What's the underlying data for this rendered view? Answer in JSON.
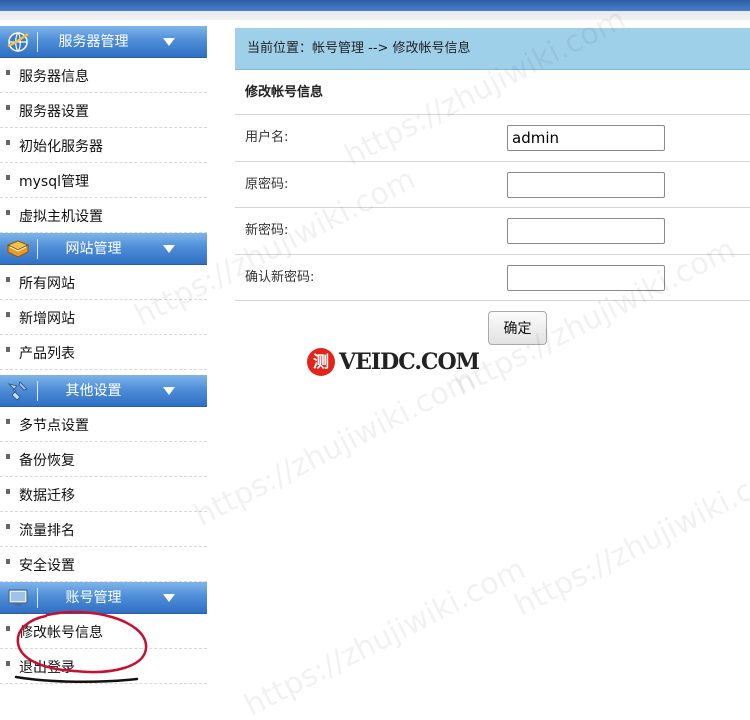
{
  "sidebar": {
    "sections": [
      {
        "title": "服务器管理",
        "items": [
          "服务器信息",
          "服务器设置",
          "初始化服务器",
          "mysql管理",
          "虚拟主机设置"
        ]
      },
      {
        "title": "网站管理",
        "items": [
          "所有网站",
          "新增网站",
          "产品列表"
        ]
      },
      {
        "title": "其他设置",
        "items": [
          "多节点设置",
          "备份恢复",
          "数据迁移",
          "流量排名",
          "安全设置"
        ]
      },
      {
        "title": "账号管理",
        "items": [
          "修改帐号信息",
          "退出登录"
        ]
      }
    ]
  },
  "breadcrumb": {
    "text": "当前位置：帐号管理 --> 修改帐号信息"
  },
  "form": {
    "title": "修改帐号信息",
    "username_label": "用户名:",
    "username_value": "admin",
    "old_password_label": "原密码:",
    "new_password_label": "新密码:",
    "confirm_password_label": "确认新密码:",
    "submit_label": "确定"
  },
  "logo": {
    "badge": "测",
    "text": "VEIDC.COM"
  },
  "watermark": "https://zhujiwiki.com",
  "colors": {
    "section_header": "#4f8fd8",
    "breadcrumb_bg": "#9fd0ea",
    "annotation": "#c8102e"
  }
}
